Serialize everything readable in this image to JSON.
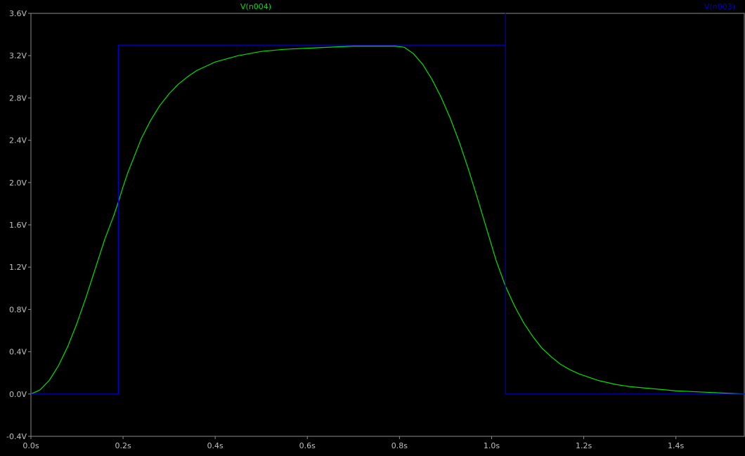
{
  "chart_data": {
    "type": "line",
    "title": "",
    "xlabel": "",
    "ylabel": "",
    "xlim": [
      0.0,
      1.55
    ],
    "ylim": [
      -0.4,
      3.6
    ],
    "x_ticks": [
      {
        "value": 0.0,
        "label": "0.0s"
      },
      {
        "value": 0.2,
        "label": "0.2s"
      },
      {
        "value": 0.4,
        "label": "0.4s"
      },
      {
        "value": 0.6,
        "label": "0.6s"
      },
      {
        "value": 0.8,
        "label": "0.8s"
      },
      {
        "value": 1.0,
        "label": "1.0s"
      },
      {
        "value": 1.2,
        "label": "1.2s"
      },
      {
        "value": 1.4,
        "label": "1.4s"
      }
    ],
    "y_ticks": [
      {
        "value": 3.6,
        "label": "3.6V"
      },
      {
        "value": 3.2,
        "label": "3.2V"
      },
      {
        "value": 2.8,
        "label": "2.8V"
      },
      {
        "value": 2.4,
        "label": "2.4V"
      },
      {
        "value": 2.0,
        "label": "2.0V"
      },
      {
        "value": 1.6,
        "label": "1.6V"
      },
      {
        "value": 1.2,
        "label": "1.2V"
      },
      {
        "value": 0.8,
        "label": "0.8V"
      },
      {
        "value": 0.4,
        "label": "0.4V"
      },
      {
        "value": 0.0,
        "label": "0.0V"
      },
      {
        "value": -0.4,
        "label": "-0.4V"
      }
    ],
    "grid": false,
    "background_color": "#000000",
    "axis_color": "#8a8a8a",
    "tick_label_color": "#c0c0c0",
    "series": [
      {
        "name": "V(n004)",
        "color": "#00e000",
        "legend_position": "top-center",
        "x": [
          0.0,
          0.02,
          0.04,
          0.06,
          0.08,
          0.1,
          0.12,
          0.14,
          0.16,
          0.18,
          0.19,
          0.2,
          0.21,
          0.22,
          0.24,
          0.26,
          0.28,
          0.3,
          0.32,
          0.34,
          0.36,
          0.38,
          0.4,
          0.45,
          0.5,
          0.55,
          0.6,
          0.65,
          0.7,
          0.75,
          0.79,
          0.81,
          0.83,
          0.85,
          0.87,
          0.89,
          0.91,
          0.93,
          0.95,
          0.97,
          0.99,
          1.01,
          1.03,
          1.05,
          1.07,
          1.09,
          1.11,
          1.13,
          1.15,
          1.17,
          1.19,
          1.21,
          1.23,
          1.25,
          1.27,
          1.3,
          1.35,
          1.4,
          1.45,
          1.5,
          1.55
        ],
        "y": [
          0.0,
          0.04,
          0.13,
          0.27,
          0.45,
          0.67,
          0.92,
          1.19,
          1.46,
          1.69,
          1.82,
          1.96,
          2.09,
          2.2,
          2.42,
          2.59,
          2.73,
          2.84,
          2.93,
          3.0,
          3.06,
          3.1,
          3.14,
          3.2,
          3.24,
          3.26,
          3.27,
          3.28,
          3.29,
          3.29,
          3.29,
          3.28,
          3.22,
          3.12,
          2.98,
          2.81,
          2.61,
          2.38,
          2.12,
          1.84,
          1.55,
          1.26,
          1.02,
          0.83,
          0.67,
          0.54,
          0.43,
          0.35,
          0.28,
          0.23,
          0.19,
          0.16,
          0.13,
          0.11,
          0.09,
          0.07,
          0.05,
          0.03,
          0.02,
          0.01,
          0.0
        ]
      },
      {
        "name": "V(n003)",
        "color": "#0000c8",
        "legend_position": "top-right",
        "x": [
          0.0,
          0.19,
          0.19,
          1.03,
          1.03,
          1.03,
          1.03,
          1.55
        ],
        "y": [
          0.0,
          0.0,
          3.3,
          3.3,
          3.6,
          3.3,
          0.0,
          0.0
        ]
      }
    ]
  }
}
